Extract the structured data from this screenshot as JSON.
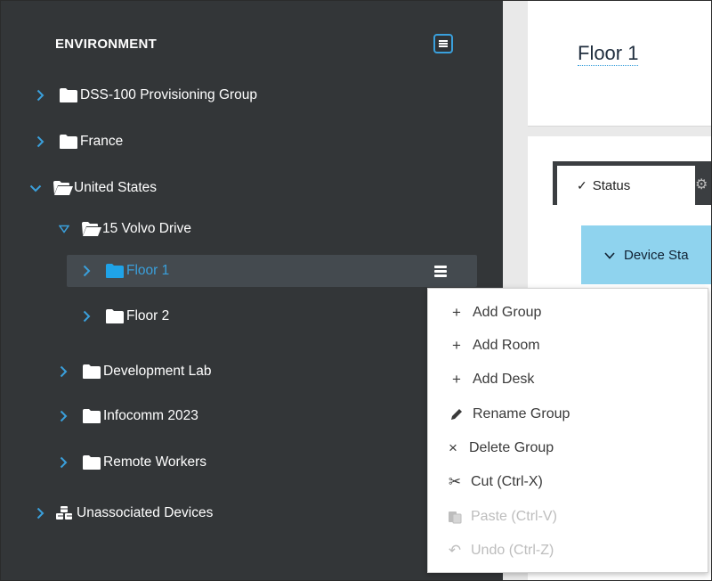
{
  "sidebar": {
    "title": "ENVIRONMENT",
    "menu_icon": "hamburger-icon",
    "tree": [
      {
        "label": "DSS-100 Provisioning Group",
        "expanded": false
      },
      {
        "label": "France",
        "expanded": false
      },
      {
        "label": "United States",
        "expanded": true
      },
      {
        "label": "15 Volvo Drive",
        "expanded": true
      },
      {
        "label": "Floor 1",
        "expanded": false,
        "selected": true
      },
      {
        "label": "Floor 2",
        "expanded": false
      },
      {
        "label": "Development Lab",
        "expanded": false
      },
      {
        "label": "Infocomm 2023",
        "expanded": false
      },
      {
        "label": "Remote Workers",
        "expanded": false
      },
      {
        "label": "Unassociated Devices",
        "expanded": false
      }
    ]
  },
  "header": {
    "title": "Floor 1"
  },
  "tabs": {
    "status_label": "Status"
  },
  "panel": {
    "device_status_label": "Device Sta"
  },
  "context_menu": {
    "items": [
      {
        "label": "Add Group",
        "icon": "plus-icon",
        "enabled": true
      },
      {
        "label": "Add Room",
        "icon": "plus-icon",
        "enabled": true
      },
      {
        "label": "Add Desk",
        "icon": "plus-icon",
        "enabled": true
      },
      {
        "label": "Rename Group",
        "icon": "pencil-icon",
        "enabled": true
      },
      {
        "label": "Delete Group",
        "icon": "x-icon",
        "enabled": true
      },
      {
        "label": "Cut (Ctrl-X)",
        "icon": "scissors-icon",
        "enabled": true
      },
      {
        "label": "Paste (Ctrl-V)",
        "icon": "paste-icon",
        "enabled": false
      },
      {
        "label": "Undo (Ctrl-Z)",
        "icon": "undo-icon",
        "enabled": false
      }
    ]
  },
  "colors": {
    "sidebar_bg": "#333638",
    "accent": "#3aa0dc",
    "selected_text": "#3aa0dc",
    "panel_header": "#8fd3ee"
  }
}
